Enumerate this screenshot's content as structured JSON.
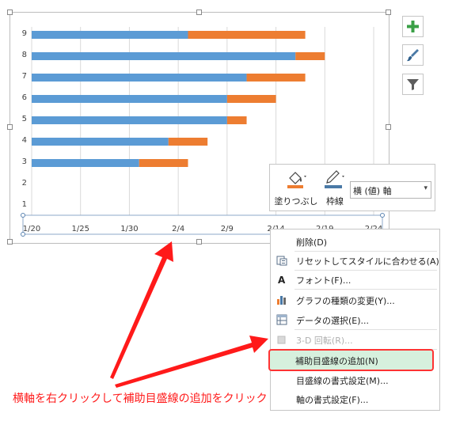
{
  "chart_data": {
    "type": "bar",
    "orientation": "horizontal",
    "stacked": true,
    "y_categories": [
      "1",
      "2",
      "3",
      "4",
      "5",
      "6",
      "7",
      "8",
      "9"
    ],
    "x_tick_labels": [
      "1/20",
      "1/25",
      "1/30",
      "2/4",
      "2/9",
      "2/14",
      "2/19",
      "2/24"
    ],
    "x_range": [
      "1/20",
      "2/24"
    ],
    "series": [
      {
        "values_start": [
          "",
          "",
          "2017-01-31",
          "2017-02-03",
          "2017-02-09",
          "2017-02-09",
          "2017-02-11",
          "2017-02-16",
          "2017-02-05"
        ],
        "color": "#5b9bd5"
      },
      {
        "values_end": [
          "",
          "",
          "2017-02-05",
          "2017-02-07",
          "2017-02-11",
          "2017-02-14",
          "2017-02-17",
          "2017-02-19",
          "2017-02-17"
        ],
        "color": "#ed7d31"
      }
    ],
    "grid_vertical": true,
    "legend": "none"
  },
  "side_buttons": [
    {
      "icon": "plus-icon"
    },
    {
      "icon": "brush-icon"
    },
    {
      "icon": "filter-icon"
    }
  ],
  "mini_toolbar": {
    "fill_label": "塗りつぶし",
    "outline_label": "枠線",
    "element_select": "横 (値) 軸"
  },
  "context_menu": {
    "items": [
      {
        "label": "削除(D)",
        "icon": "",
        "disabled": false
      },
      {
        "label": "リセットしてスタイルに合わせる(A)",
        "icon": "reset-icon",
        "disabled": false
      },
      {
        "label": "フォント(F)...",
        "icon": "font-icon",
        "disabled": false
      },
      {
        "label": "グラフの種類の変更(Y)...",
        "icon": "chart-type-icon",
        "disabled": false
      },
      {
        "label": "データの選択(E)...",
        "icon": "select-data-icon",
        "disabled": false
      },
      {
        "label": "3-D 回転(R)...",
        "icon": "rotate-3d-icon",
        "disabled": true
      },
      {
        "label": "補助目盛線の追加(N)",
        "icon": "",
        "disabled": false,
        "highlighted": true
      },
      {
        "label": "目盛線の書式設定(M)...",
        "icon": "",
        "disabled": false
      },
      {
        "label": "軸の書式設定(F)...",
        "icon": "",
        "disabled": false
      }
    ]
  },
  "annotation": {
    "caption": "横軸を右クリックして補助目盛線の追加をクリック",
    "color": "#ff1a1a"
  },
  "colors": {
    "bar_start": "#5b9bd5",
    "bar_duration": "#ed7d31",
    "highlight_bg": "#d6f0dd",
    "highlight_border": "#ff3333",
    "plus_green": "#3aa046"
  }
}
